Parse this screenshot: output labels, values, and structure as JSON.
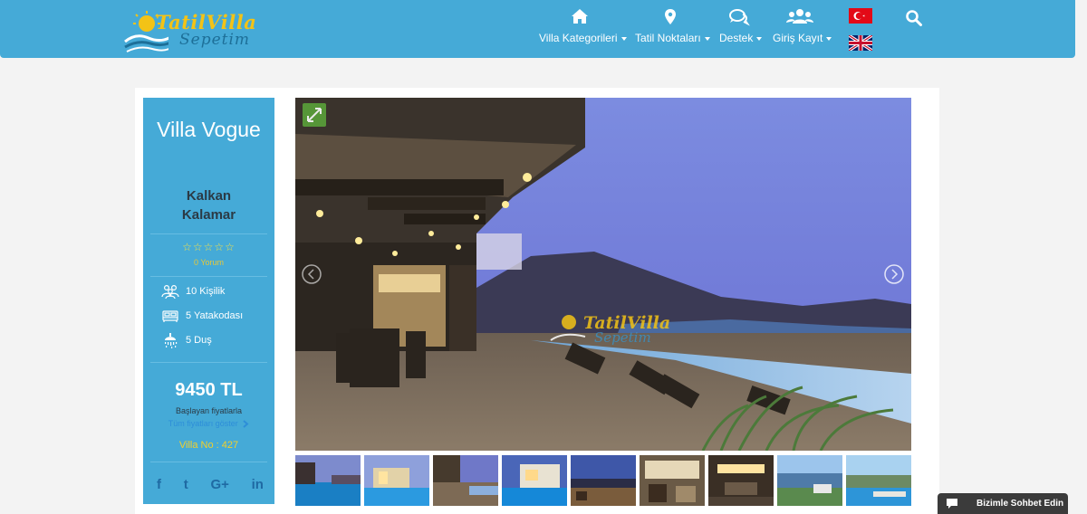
{
  "logo": {
    "line1": "TatilVilla",
    "line2": "Sepetim"
  },
  "nav": {
    "items": [
      {
        "label": "Villa Kategorileri",
        "icon": "home-icon"
      },
      {
        "label": "Tatil Noktaları",
        "icon": "map-marker-icon"
      },
      {
        "label": "Destek",
        "icon": "chat-bubbles-icon"
      },
      {
        "label": "Giriş Kayıt",
        "icon": "users-icon"
      }
    ],
    "languages": [
      "Türkçe",
      "English"
    ]
  },
  "villa": {
    "title": "Villa Vogue",
    "location_line1": "Kalkan",
    "location_line2": "Kalamar",
    "stars": "☆☆☆☆☆",
    "reviews": "0 Yorum",
    "features": [
      {
        "icon": "people-icon",
        "label": "10 Kişilik"
      },
      {
        "icon": "bed-icon",
        "label": "5 Yatakodası"
      },
      {
        "icon": "shower-icon",
        "label": "5 Duş"
      }
    ],
    "price": "9450 TL",
    "price_note": "Başlayan fiyatlarla",
    "price_link": "Tüm fiyatları göster",
    "villa_no": "Villa No : 427"
  },
  "social": [
    "f",
    "t",
    "G+",
    "in"
  ],
  "gallery": {
    "watermark_line1": "TatilVilla",
    "watermark_line2": "Sepetim",
    "thumb_count": 9
  },
  "chat": {
    "label": "Bizimle Sohbet Edin"
  },
  "colors": {
    "header": "#45aad7",
    "sidebar": "#45aad7",
    "star": "#f3e04a",
    "price_link": "#2d8ed8"
  }
}
